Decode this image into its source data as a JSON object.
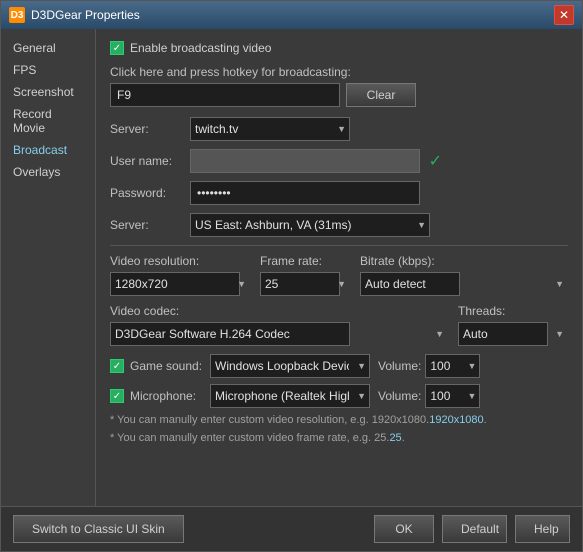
{
  "window": {
    "title": "D3DGear Properties",
    "icon": "D3",
    "close_label": "✕"
  },
  "sidebar": {
    "items": [
      {
        "label": "General",
        "active": false
      },
      {
        "label": "FPS",
        "active": false
      },
      {
        "label": "Screenshot",
        "active": false
      },
      {
        "label": "Record Movie",
        "active": false
      },
      {
        "label": "Broadcast",
        "active": true
      },
      {
        "label": "Overlays",
        "active": false
      }
    ]
  },
  "main": {
    "enable_checkbox_label": "Enable broadcasting video",
    "hotkey_label": "Click here and press hotkey for broadcasting:",
    "hotkey_value": "F9",
    "clear_button": "Clear",
    "server_label": "Server:",
    "server_value": "twitch.tv",
    "username_label": "User name:",
    "username_value": "",
    "password_label": "Password:",
    "password_value": "••••••••",
    "server2_label": "Server:",
    "server2_value": "US East: Ashburn, VA   (31ms)",
    "video_res_label": "Video resolution:",
    "video_res_value": "1280x720",
    "framerate_label": "Frame rate:",
    "framerate_value": "25",
    "bitrate_label": "Bitrate (kbps):",
    "bitrate_value": "Auto detect",
    "video_codec_label": "Video codec:",
    "video_codec_value": "D3DGear Software H.264 Codec",
    "threads_label": "Threads:",
    "threads_value": "Auto",
    "game_sound_label": "Game sound:",
    "game_sound_device": "Windows Loopback Device",
    "game_sound_volume_label": "Volume:",
    "game_sound_volume": "100",
    "microphone_label": "Microphone:",
    "microphone_device": "Microphone (Realtek High Defir...",
    "microphone_volume_label": "Volume:",
    "microphone_volume": "100",
    "note1": "* You can manully enter custom video resolution, e.g. 1920x1080.",
    "note1_link": "1920x1080",
    "note2": "* You can manully enter custom video frame rate, e.g. 25.",
    "note2_link": "25"
  },
  "bottom": {
    "switch_skin_label": "Switch to Classic UI Skin",
    "ok_label": "OK",
    "default_label": "Default",
    "help_label": "Help"
  },
  "colors": {
    "accent_blue": "#87ceeb",
    "green": "#27ae60",
    "bg_dark": "#2b2b2b",
    "bg_panel": "#3a3a3a",
    "text_main": "#d0d0d0",
    "text_label": "#c0c0c0"
  }
}
